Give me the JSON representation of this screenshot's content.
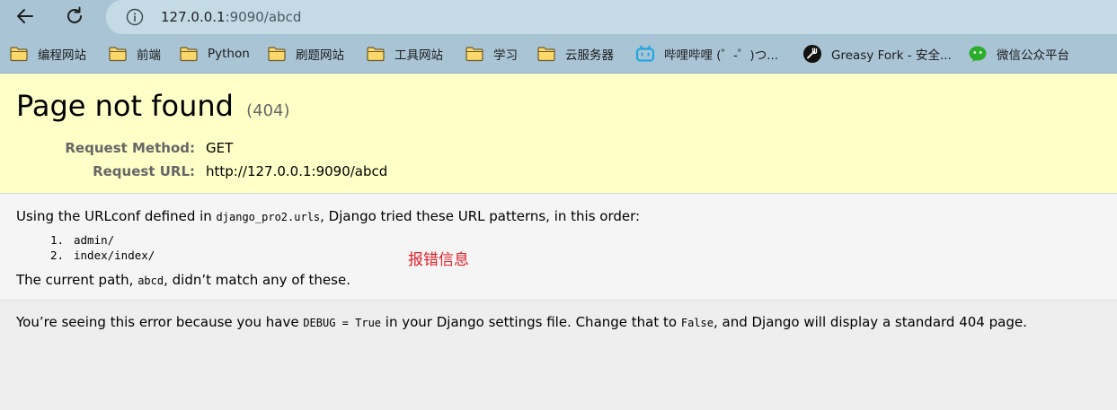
{
  "browser": {
    "url_host": "127.0.0.1",
    "url_rest": ":9090/abcd",
    "bookmarks": [
      {
        "label": "编程网站",
        "icon": "folder-icon"
      },
      {
        "label": "前端",
        "icon": "folder-icon"
      },
      {
        "label": "Python",
        "icon": "folder-icon"
      },
      {
        "label": "刷题网站",
        "icon": "folder-icon"
      },
      {
        "label": "工具网站",
        "icon": "folder-icon"
      },
      {
        "label": "学习",
        "icon": "folder-icon"
      },
      {
        "label": "云服务器",
        "icon": "folder-icon"
      },
      {
        "label": "哔哩哔哩 (゜-゜)つ...",
        "icon": "bilibili-icon"
      },
      {
        "label": "Greasy Fork - 安全...",
        "icon": "greasyfork-icon"
      },
      {
        "label": "微信公众平台",
        "icon": "wechat-icon"
      }
    ],
    "colors": {
      "toolbar": "#a9c4d5",
      "address_bar": "#c4dae5",
      "folder": "#f3c33c",
      "bilibili": "#21a6e0",
      "wechat": "#2aae2a"
    }
  },
  "page": {
    "title": "Page not found",
    "status": "(404)",
    "request_method_label": "Request Method:",
    "request_method_value": "GET",
    "request_url_label": "Request URL:",
    "request_url_value": "http://127.0.0.1:9090/abcd",
    "urlconf_prefix": "Using the URLconf defined in ",
    "urlconf_module": "django_pro2.urls",
    "urlconf_suffix": ", Django tried these URL patterns, in this order:",
    "patterns": [
      {
        "number": "1.",
        "pattern": "admin/"
      },
      {
        "number": "2.",
        "pattern": "index/index/"
      }
    ],
    "current_path_prefix": "The current path, ",
    "current_path_value": "abcd",
    "current_path_suffix": ", didn’t match any of these.",
    "annotation": "报错信息",
    "explanation_prefix": "You’re seeing this error because you have ",
    "debug_code": "DEBUG = True",
    "explanation_middle": " in your Django settings file. Change that to ",
    "false_code": "False",
    "explanation_suffix": ", and Django will display a standard 404 page.",
    "colors": {
      "summary_bg": "#ffffc8",
      "info_bg": "#f5f5f5",
      "body_bg": "#eeeeee",
      "annotation": "#e0202a"
    }
  }
}
